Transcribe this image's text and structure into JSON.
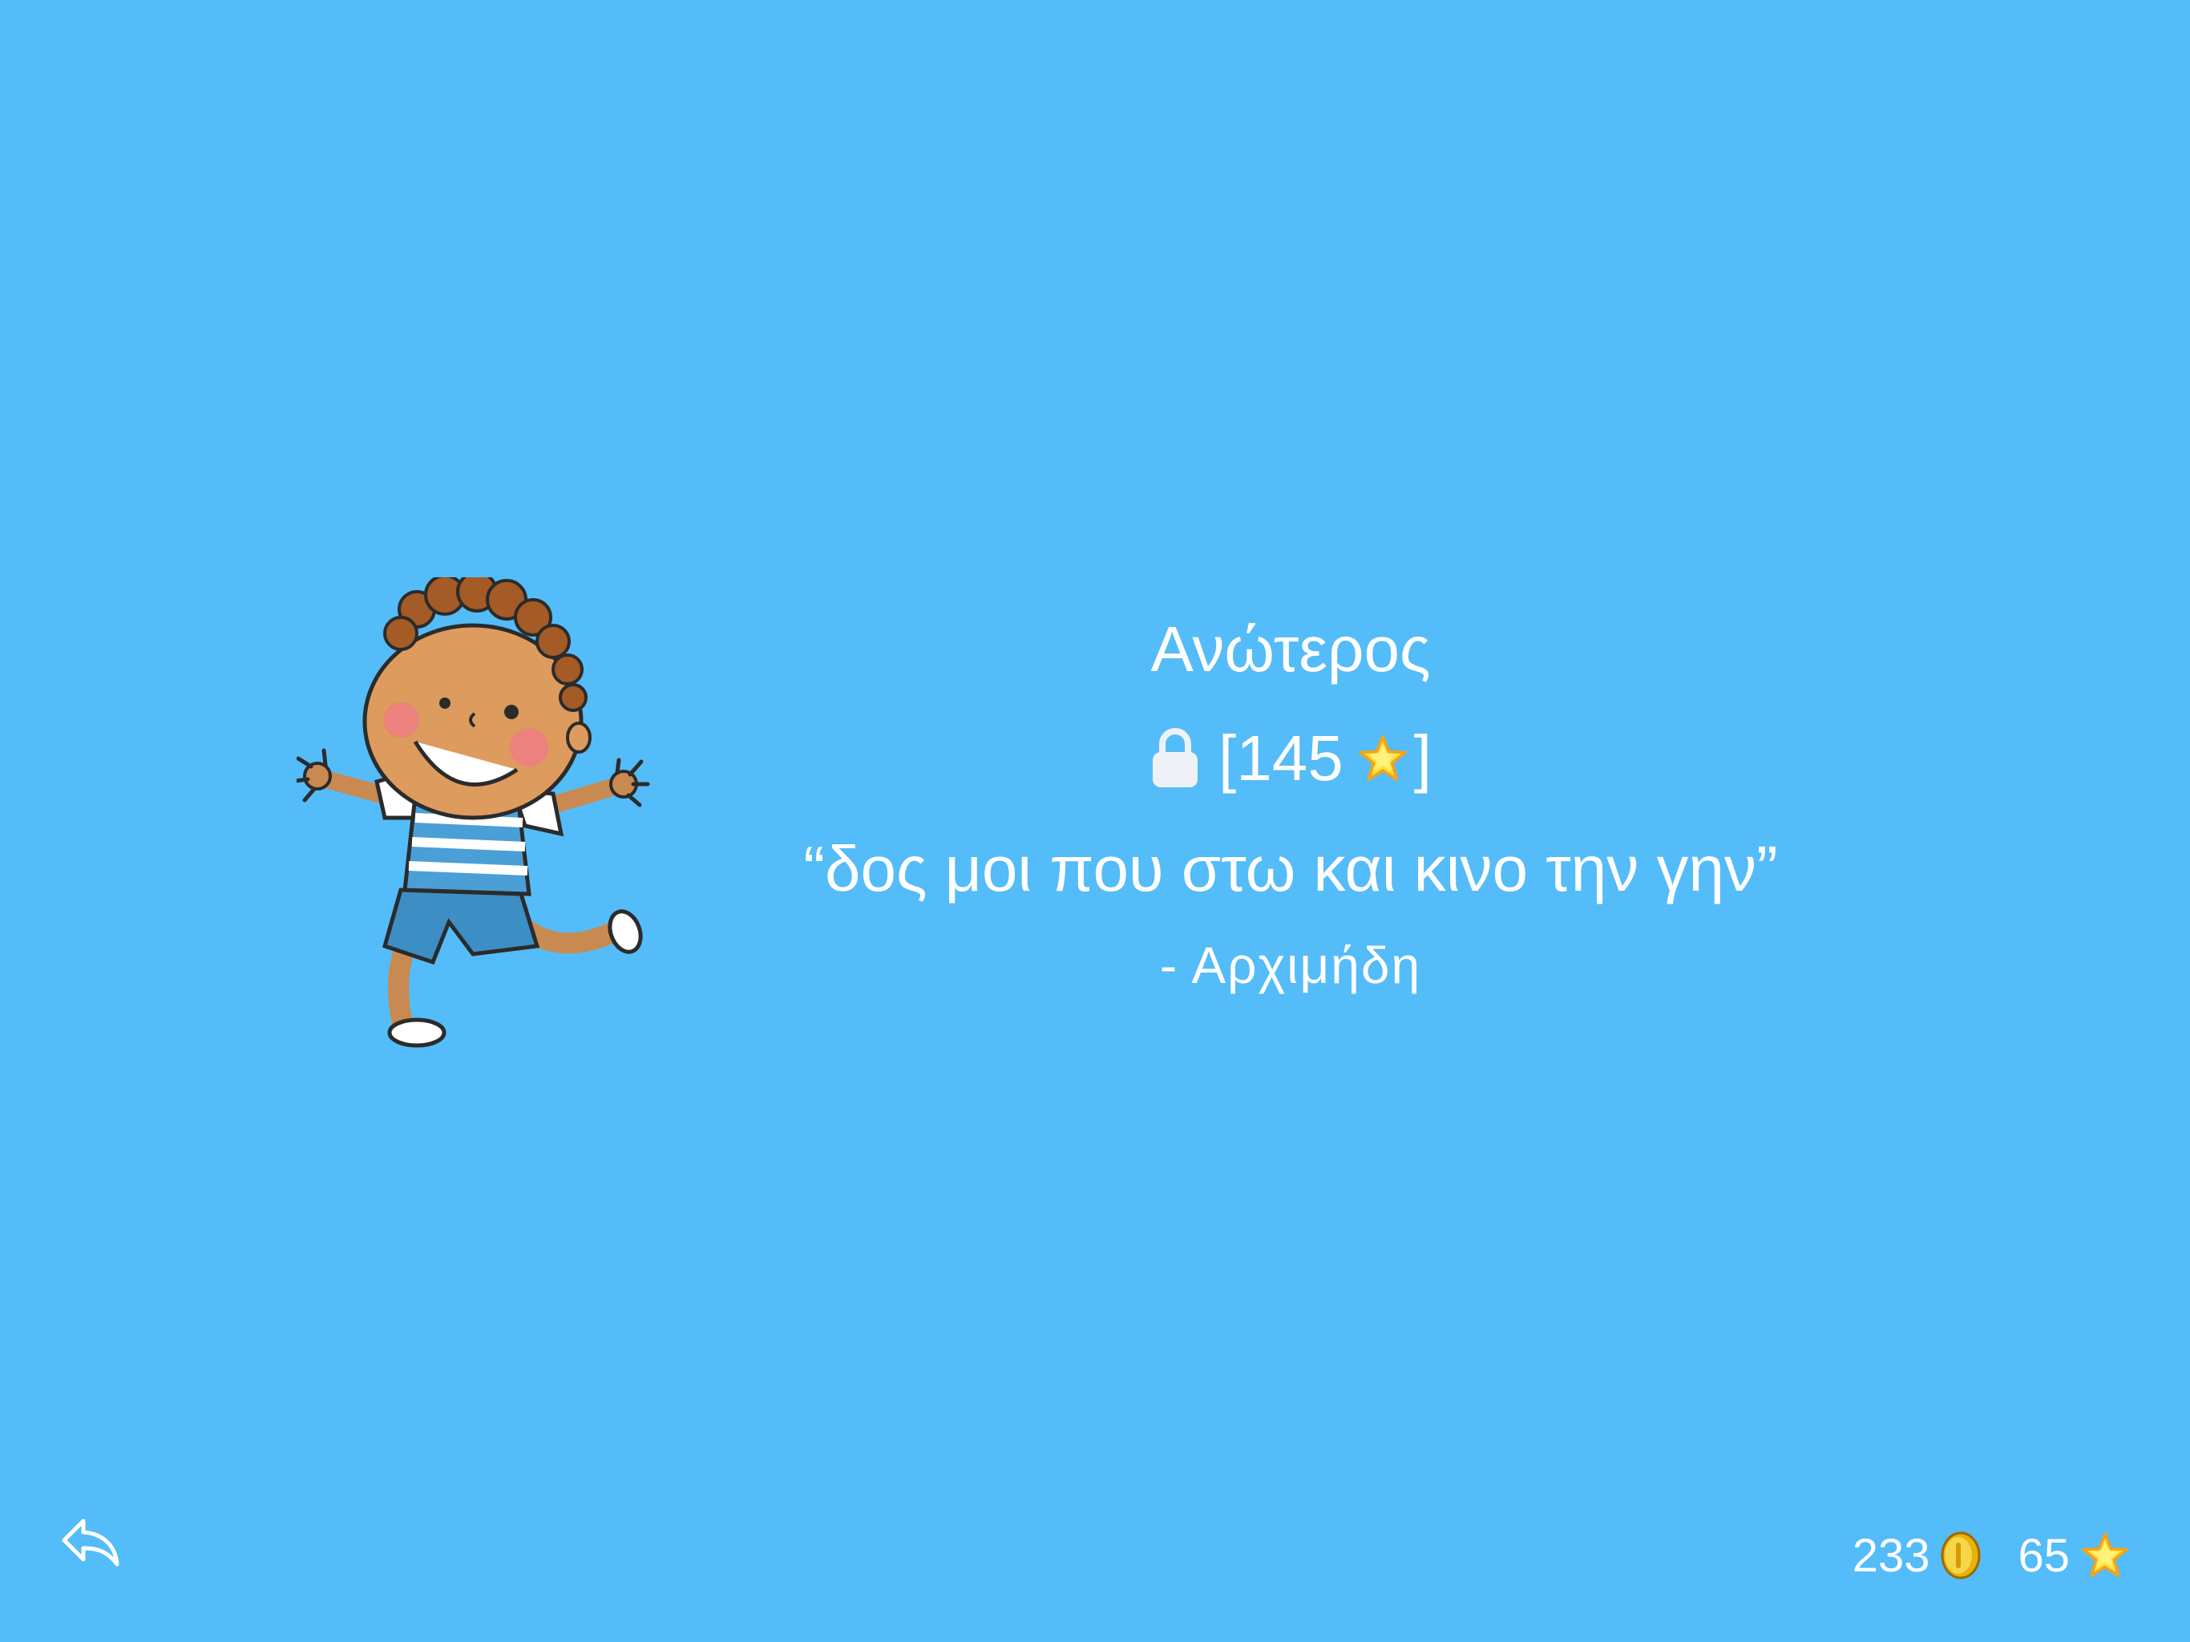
{
  "level": {
    "title": "Ανώτερος",
    "requirement": "[145",
    "requirement_close": "]",
    "lock_icon": "lock-icon",
    "star_icon": "star-icon"
  },
  "quote": {
    "text": "“δος μοι που στω και κινο την γην”",
    "author": "- Αρχιμήδη"
  },
  "footer": {
    "back_icon": "reply-arrow-icon",
    "coins": "233",
    "stars": "65"
  },
  "colors": {
    "background": "#54bcf8",
    "text": "#ffffff",
    "coin": "#f2c21a",
    "star": "#ffe13a"
  }
}
